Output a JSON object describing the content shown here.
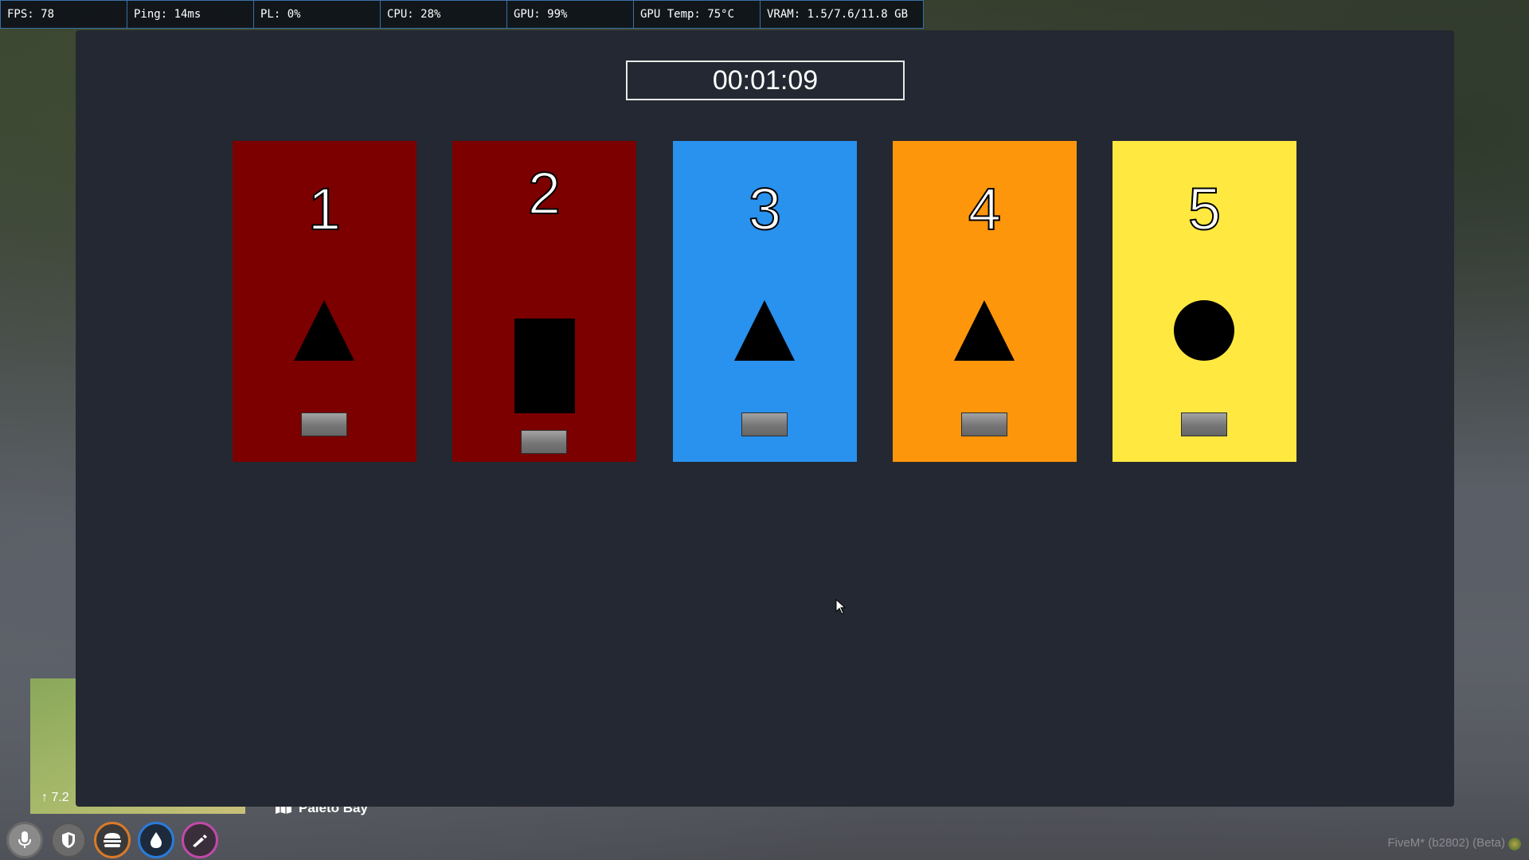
{
  "perf": {
    "fps": "FPS: 78",
    "ping": "Ping: 14ms",
    "pl": "PL: 0%",
    "cpu": "CPU: 28%",
    "gpu": "GPU: 99%",
    "gpu_temp": "GPU Temp: 75°C",
    "vram": "VRAM: 1.5/7.6/11.8 GB"
  },
  "timer": "00:01:09",
  "cards": [
    {
      "number": "1",
      "color": "#7c0000",
      "shape": "triangle-icon"
    },
    {
      "number": "2",
      "color": "#7c0000",
      "shape": "rectangle-icon"
    },
    {
      "number": "3",
      "color": "#2991ee",
      "shape": "triangle-icon"
    },
    {
      "number": "4",
      "color": "#fe960b",
      "shape": "triangle-icon"
    },
    {
      "number": "5",
      "color": "#ffe941",
      "shape": "circle-icon"
    }
  ],
  "hud": {
    "speed": "↑ 7.2",
    "location": "Paleto Bay",
    "icons": [
      "microphone-icon",
      "shield-icon",
      "burger-icon",
      "water-drop-icon",
      "stamina-icon"
    ],
    "icon_colors": [
      "#8a8a8a",
      "#6b6b6b",
      "#d97a2a",
      "#2a7bd9",
      "#c04aa8"
    ]
  },
  "footer": {
    "build": "FiveM* (b2802) (Beta)"
  }
}
